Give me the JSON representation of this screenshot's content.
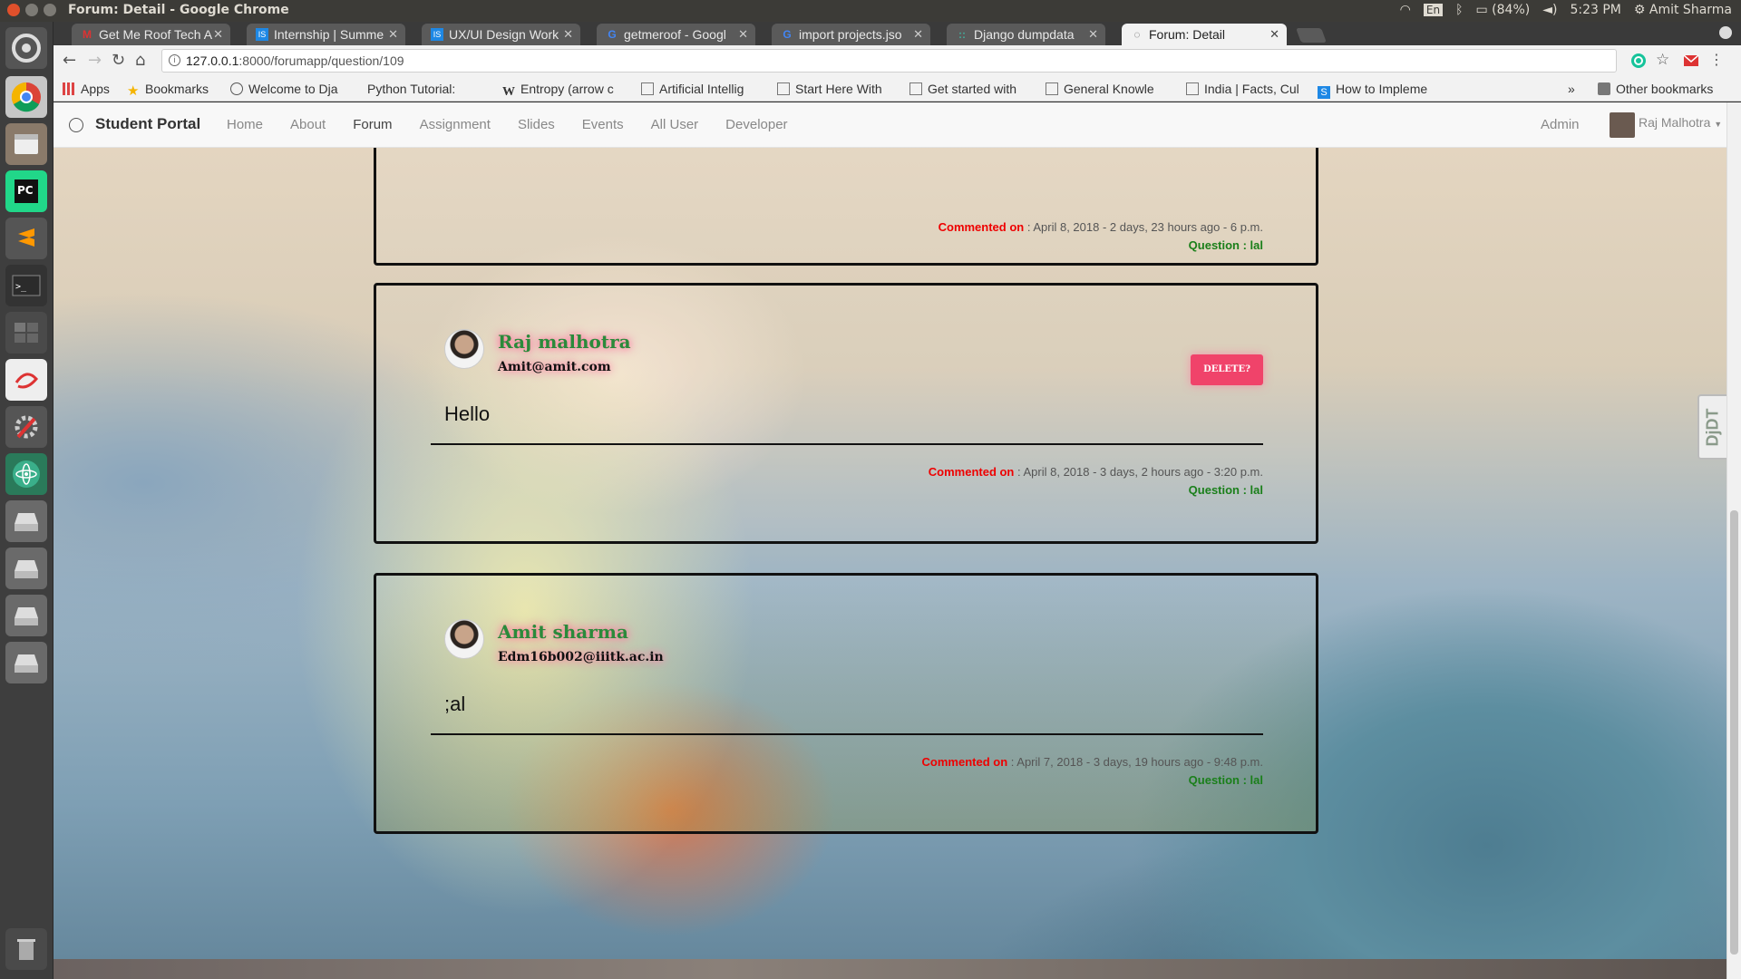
{
  "system": {
    "window_title": "Forum: Detail - Google Chrome",
    "tray": {
      "lang": "En",
      "battery": "(84%)",
      "time": "5:23 PM",
      "user": "Amit Sharma"
    }
  },
  "launcher": {
    "items": [
      "home-icon",
      "chrome-icon",
      "files-icon",
      "pycharm-icon",
      "sublime-icon",
      "terminal-icon",
      "workspace-icon",
      "text-editor-icon",
      "settings-icon",
      "atom-icon",
      "drive-icon",
      "drive-icon",
      "drive-icon",
      "drive-icon",
      "trash-icon"
    ]
  },
  "browser": {
    "tabs": [
      {
        "label": "Get Me Roof Tech A",
        "fav": "M"
      },
      {
        "label": "Internship | Summe",
        "fav": "IS"
      },
      {
        "label": "UX/UI Design Work",
        "fav": "IS"
      },
      {
        "label": "getmeroof - Googl",
        "fav": "G"
      },
      {
        "label": "import projects.jso",
        "fav": "G"
      },
      {
        "label": "Django dumpdata",
        "fav": "::"
      },
      {
        "label": "Forum: Detail",
        "fav": "◌"
      }
    ],
    "url_host": "127.0.0.1",
    "url_rest": ":8000/forumapp/question/109",
    "bookmarks": [
      {
        "label": "Apps"
      },
      {
        "label": "Bookmarks"
      },
      {
        "label": "Welcome to Dja"
      },
      {
        "label": "Python Tutorial:"
      },
      {
        "label": "Entropy (arrow c"
      },
      {
        "label": "Artificial Intellig"
      },
      {
        "label": "Start Here With"
      },
      {
        "label": "Get started with"
      },
      {
        "label": "General Knowle"
      },
      {
        "label": "India | Facts, Cul"
      },
      {
        "label": "How to Impleme"
      }
    ],
    "bookmarks_more": "»",
    "other_bookmarks": "Other bookmarks"
  },
  "site": {
    "brand": "Student Portal",
    "nav": [
      "Home",
      "About",
      "Forum",
      "Assignment",
      "Slides",
      "Events",
      "All User",
      "Developer"
    ],
    "active_nav": "Forum",
    "admin": "Admin",
    "user": "Raj Malhotra"
  },
  "comments": [
    {
      "commented_label": "Commented on",
      "commented_value": " : April 8, 2018 - 2 days, 23 hours ago - 6 p.m.",
      "question": "Question : lal"
    },
    {
      "name": "Raj malhotra",
      "email": "Amit@amit.com",
      "message": "Hello",
      "delete_label": "DELETE?",
      "commented_label": "Commented on",
      "commented_value": " : April 8, 2018 - 3 days, 2 hours ago - 3:20 p.m.",
      "question": "Question : lal"
    },
    {
      "name": "Amit sharma",
      "email": "Edm16b002@iiitk.ac.in",
      "message": ";al",
      "commented_label": "Commented on",
      "commented_value": " : April 7, 2018 - 3 days, 19 hours ago - 9:48 p.m.",
      "question": "Question : lal"
    }
  ],
  "ddt_label": "DjDT"
}
